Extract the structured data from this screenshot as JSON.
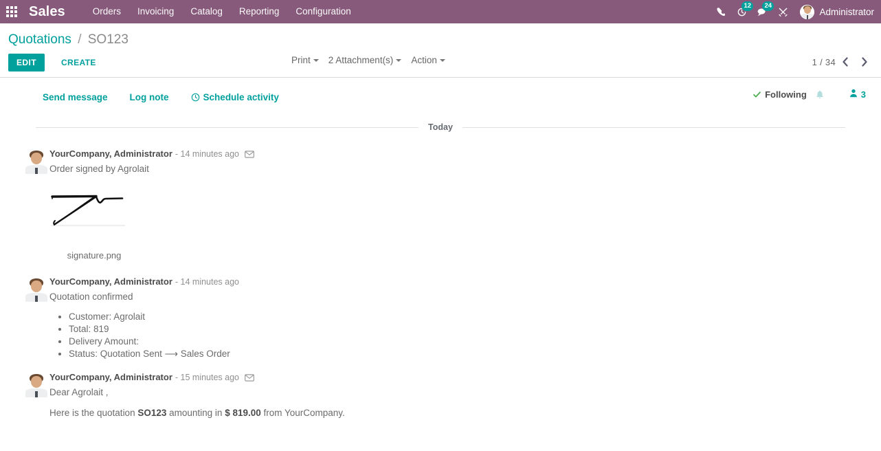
{
  "navbar": {
    "apps_icon": "apps-grid-icon",
    "brand": "Sales",
    "menu": [
      {
        "label": "Orders"
      },
      {
        "label": "Invoicing"
      },
      {
        "label": "Catalog"
      },
      {
        "label": "Reporting"
      },
      {
        "label": "Configuration"
      }
    ],
    "icons": {
      "phone": "phone-icon",
      "activity": "clock-activity-icon",
      "activity_badge": "12",
      "messages": "messages-icon",
      "messages_badge": "24",
      "tools": "tools-icon"
    },
    "user": {
      "name": "Administrator",
      "avatar": "user-avatar"
    },
    "colors": {
      "background": "#875A7B",
      "badge": "#00A09D"
    }
  },
  "control_panel": {
    "breadcrumb": {
      "root": "Quotations",
      "separator": "/",
      "current": "SO123"
    },
    "buttons": {
      "edit": "EDIT",
      "create": "CREATE"
    },
    "dropdowns": [
      {
        "label": "Print"
      },
      {
        "label": "2 Attachment(s)"
      },
      {
        "label": "Action"
      }
    ],
    "pager": {
      "value": "1 / 34",
      "prev_icon": "chevron-left-icon",
      "next_icon": "chevron-right-icon"
    },
    "colors": {
      "accent": "#00A09D",
      "link": "#00A09D",
      "current_crumb": "#8a8a8a"
    }
  },
  "chatter": {
    "actions": [
      {
        "label": "Send message",
        "icon": null
      },
      {
        "label": "Log note",
        "icon": null
      },
      {
        "label": "Schedule activity",
        "icon": "clock-icon"
      }
    ],
    "followers": {
      "following_label": "Following",
      "check_icon": "check-icon",
      "bell_icon": "bell-icon",
      "person_icon": "person-icon",
      "count": "3"
    },
    "date_separator": "Today",
    "messages": [
      {
        "author": "YourCompany, Administrator",
        "time": "- 14 minutes ago",
        "has_mail_icon": true,
        "body": "Order signed by Agrolait",
        "attachment": {
          "name": "signature.png",
          "type": "image-signature"
        }
      },
      {
        "author": "YourCompany, Administrator",
        "time": "- 14 minutes ago",
        "has_mail_icon": false,
        "body": "Quotation confirmed",
        "bullets": [
          "Customer: Agrolait",
          "Total: 819",
          "Delivery Amount:",
          "Status: Quotation Sent ⟶ Sales Order"
        ]
      },
      {
        "author": "YourCompany, Administrator",
        "time": "- 15 minutes ago",
        "has_mail_icon": true,
        "greeting": "Dear Agrolait ,",
        "line_parts": {
          "before": "Here is the quotation ",
          "bold1": "SO123",
          "middle": " amounting in ",
          "bold2": "$ 819.00",
          "after": " from YourCompany."
        }
      }
    ]
  }
}
